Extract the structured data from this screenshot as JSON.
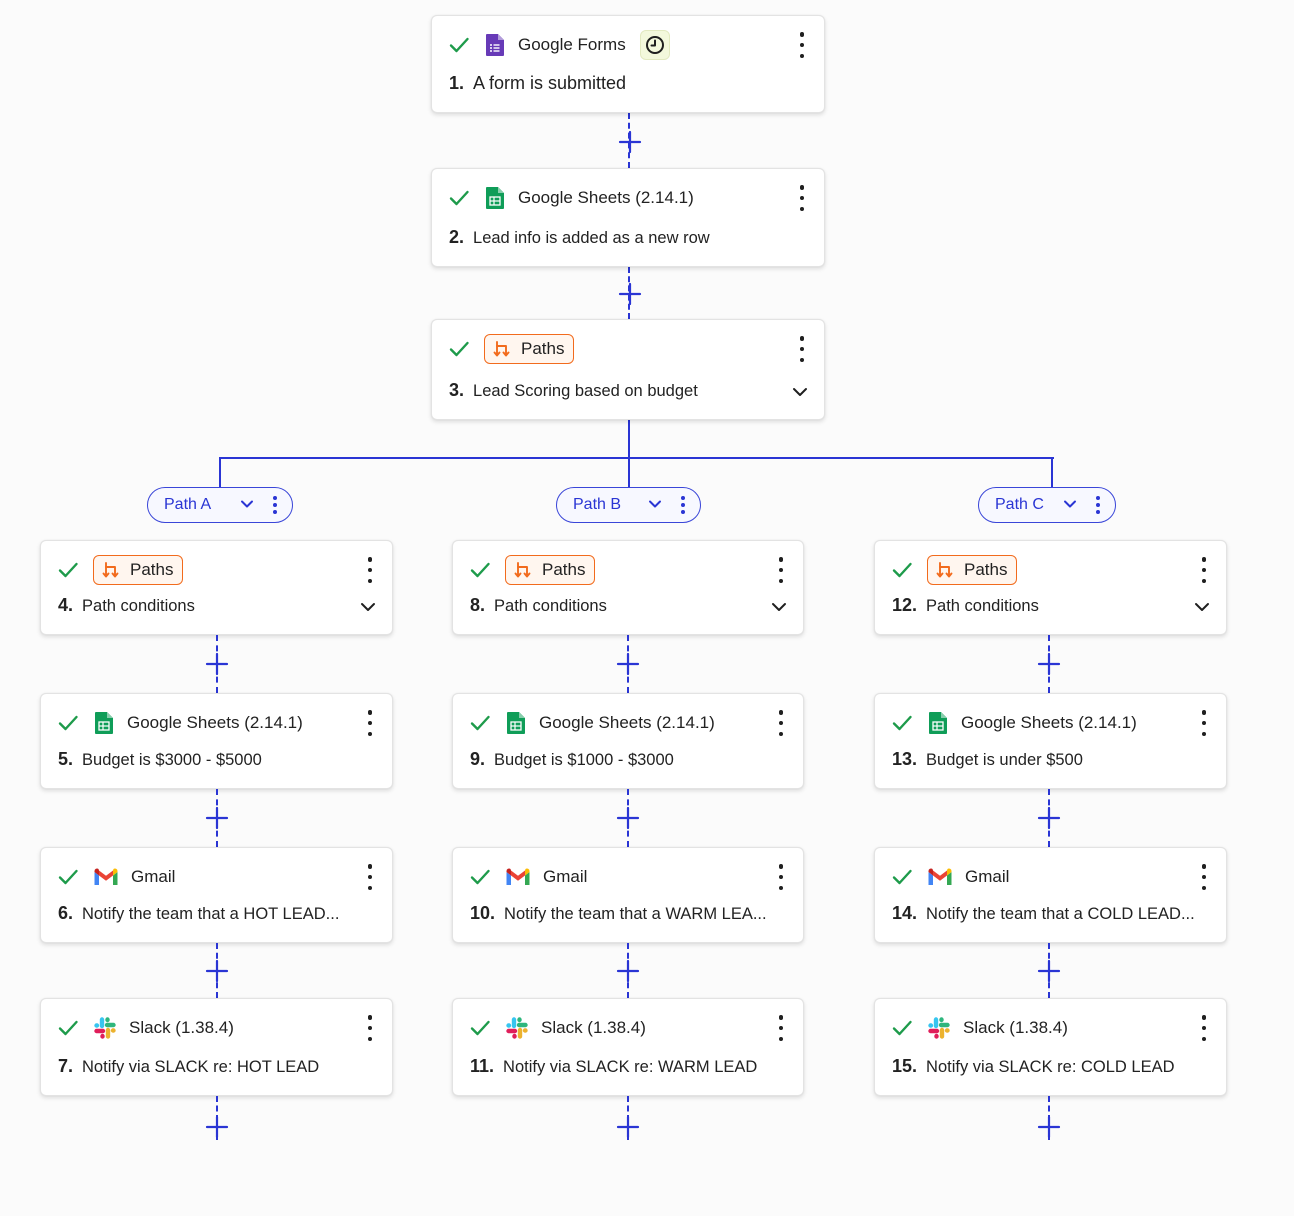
{
  "trigger": {
    "app": "Google Forms",
    "number": "1.",
    "description": "A form is submitted"
  },
  "step2": {
    "app": "Google Sheets (2.14.1)",
    "number": "2.",
    "description": "Lead info is added as a new row"
  },
  "step3": {
    "app": "Paths",
    "number": "3.",
    "description": "Lead Scoring based on budget"
  },
  "paths": [
    {
      "label": "Path A",
      "conditions": {
        "app": "Paths",
        "number": "4.",
        "description": "Path conditions"
      },
      "sheets": {
        "app": "Google Sheets (2.14.1)",
        "number": "5.",
        "description": "Budget is $3000 - $5000"
      },
      "gmail": {
        "app": "Gmail",
        "number": "6.",
        "description": "Notify the team that a HOT LEAD..."
      },
      "slack": {
        "app": "Slack (1.38.4)",
        "number": "7.",
        "description": "Notify via SLACK re: HOT LEAD"
      }
    },
    {
      "label": "Path B",
      "conditions": {
        "app": "Paths",
        "number": "8.",
        "description": "Path conditions"
      },
      "sheets": {
        "app": "Google Sheets (2.14.1)",
        "number": "9.",
        "description": "Budget is $1000 - $3000"
      },
      "gmail": {
        "app": "Gmail",
        "number": "10.",
        "description": "Notify the team that a WARM LEA..."
      },
      "slack": {
        "app": "Slack (1.38.4)",
        "number": "11.",
        "description": "Notify via SLACK re: WARM LEAD"
      }
    },
    {
      "label": "Path C",
      "conditions": {
        "app": "Paths",
        "number": "12.",
        "description": "Path conditions"
      },
      "sheets": {
        "app": "Google Sheets (2.14.1)",
        "number": "13.",
        "description": "Budget is under $500"
      },
      "gmail": {
        "app": "Gmail",
        "number": "14.",
        "description": "Notify the team that a COLD LEAD..."
      },
      "slack": {
        "app": "Slack (1.38.4)",
        "number": "15.",
        "description": "Notify via SLACK re: COLD LEAD"
      }
    }
  ],
  "icons": {
    "check": "check-icon",
    "forms": "google-forms-icon",
    "clock": "clock-icon",
    "sheets": "google-sheets-icon",
    "paths": "paths-icon",
    "gmail": "gmail-icon",
    "slack": "slack-icon",
    "more": "more-vertical-icon",
    "expand": "chevron-down-icon",
    "add": "plus-icon"
  },
  "colors": {
    "accent": "#2a35d4",
    "success": "#1e9b4b",
    "paths": "#f26b1d"
  }
}
